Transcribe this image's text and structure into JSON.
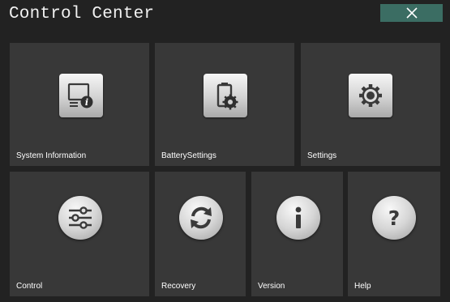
{
  "window": {
    "title": "Control Center",
    "close_icon": "close-icon",
    "close_color": "#3b6d63"
  },
  "tiles": [
    {
      "label": "System Information",
      "icon": "system-information-icon"
    },
    {
      "label": "BatterySettings",
      "icon": "battery-settings-icon"
    },
    {
      "label": "Settings",
      "icon": "gear-icon"
    },
    {
      "label": "Control",
      "icon": "sliders-icon"
    },
    {
      "label": "Recovery",
      "icon": "refresh-icon"
    },
    {
      "label": "Version",
      "icon": "info-icon"
    },
    {
      "label": "Help",
      "icon": "help-icon"
    }
  ]
}
